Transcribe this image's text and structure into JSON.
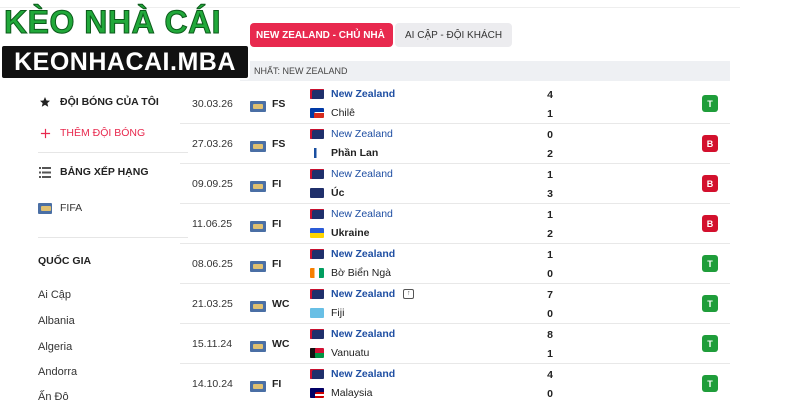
{
  "logo": {
    "top": "KÈO NHÀ CÁI",
    "bottom": "KEONHACAI.MBA"
  },
  "filters": {
    "home": "NEW ZEALAND - CHỦ NHÀ",
    "away": "AI CẬP - ĐỘI KHÁCH"
  },
  "section_title": "NHẤT: NEW ZEALAND",
  "sidebar": {
    "favorites": "ĐỘI BÓNG CỦA TÔI",
    "add_team": "THÊM ĐỘI BÓNG",
    "rankings": "BẢNG XẾP HẠNG",
    "fifa": "FIFA",
    "countries_title": "QUỐC GIA",
    "countries": [
      "Ai Cập",
      "Albania",
      "Algeria",
      "Andorra",
      "Ấn Độ"
    ]
  },
  "colors": {
    "accent": "#e8294e",
    "win": "#1f9d3a",
    "loss": "#d3102d",
    "team_link": "#1f4fa3"
  },
  "matches": [
    {
      "date": "30.03.26",
      "comp": "FS",
      "team1": "New Zealand",
      "team2": "Chilê",
      "score1": "4",
      "score2": "1",
      "result": "T",
      "winner": 1,
      "flag1": "nz",
      "flag2": "chile",
      "tv": false
    },
    {
      "date": "27.03.26",
      "comp": "FS",
      "team1": "New Zealand",
      "team2": "Phần Lan",
      "score1": "0",
      "score2": "2",
      "result": "B",
      "winner": 2,
      "flag1": "nz",
      "flag2": "finland",
      "tv": false
    },
    {
      "date": "09.09.25",
      "comp": "FI",
      "team1": "New Zealand",
      "team2": "Úc",
      "score1": "1",
      "score2": "3",
      "result": "B",
      "winner": 2,
      "flag1": "nz",
      "flag2": "australia",
      "tv": false
    },
    {
      "date": "11.06.25",
      "comp": "FI",
      "team1": "New Zealand",
      "team2": "Ukraine",
      "score1": "1",
      "score2": "2",
      "result": "B",
      "winner": 2,
      "flag1": "nz",
      "flag2": "ukraine",
      "tv": false
    },
    {
      "date": "08.06.25",
      "comp": "FI",
      "team1": "New Zealand",
      "team2": "Bờ Biển Ngà",
      "score1": "1",
      "score2": "0",
      "result": "T",
      "winner": 1,
      "flag1": "nz",
      "flag2": "ivory",
      "tv": false
    },
    {
      "date": "21.03.25",
      "comp": "WC",
      "team1": "New Zealand",
      "team2": "Fiji",
      "score1": "7",
      "score2": "0",
      "result": "T",
      "winner": 1,
      "flag1": "nz",
      "flag2": "fiji",
      "tv": true
    },
    {
      "date": "15.11.24",
      "comp": "WC",
      "team1": "New Zealand",
      "team2": "Vanuatu",
      "score1": "8",
      "score2": "1",
      "result": "T",
      "winner": 1,
      "flag1": "nz",
      "flag2": "vanuatu",
      "tv": false
    },
    {
      "date": "14.10.24",
      "comp": "FI",
      "team1": "New Zealand",
      "team2": "Malaysia",
      "score1": "4",
      "score2": "0",
      "result": "T",
      "winner": 1,
      "flag1": "nz",
      "flag2": "malaysia",
      "tv": false
    }
  ]
}
